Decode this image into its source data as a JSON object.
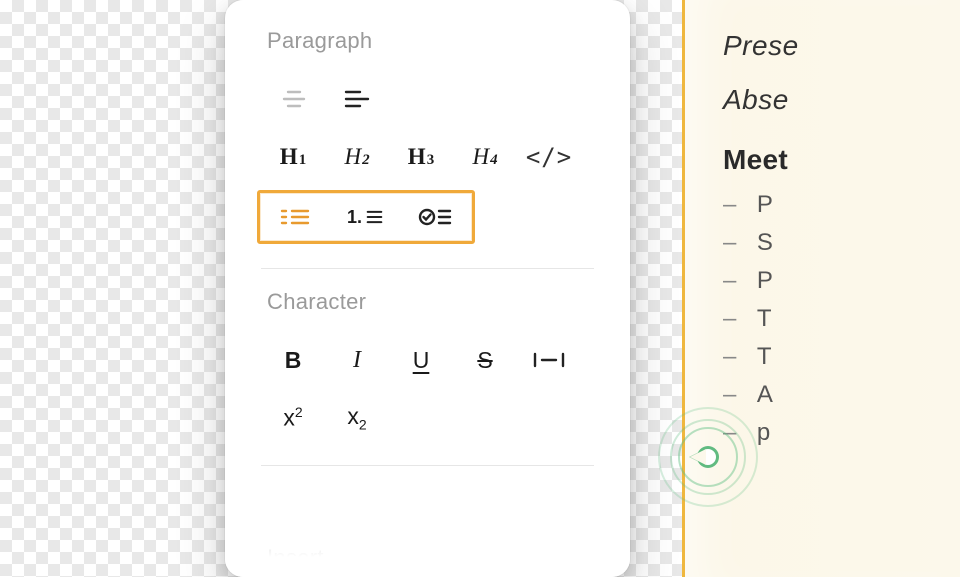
{
  "panel": {
    "sections": {
      "paragraph": {
        "label": "Paragraph"
      },
      "character": {
        "label": "Character"
      },
      "insert": {
        "label": "Insert"
      }
    },
    "headings": {
      "h1": "H",
      "h1n": "1",
      "h2": "H",
      "h2n": "2",
      "h3": "H",
      "h3n": "3",
      "h4": "H",
      "h4n": "4"
    },
    "code_label": "</>",
    "numbered_prefix": "1.",
    "char": {
      "bold": "B",
      "italic": "I",
      "underline": "U",
      "strike": "S"
    },
    "superscript_base": "x",
    "superscript_exp": "2",
    "subscript_base": "x",
    "subscript_exp": "2"
  },
  "doc": {
    "present": "Prese",
    "absent": "Abse",
    "heading": "Meet",
    "items": [
      "P",
      "S",
      "P",
      "T",
      "T",
      "A",
      "p"
    ]
  }
}
